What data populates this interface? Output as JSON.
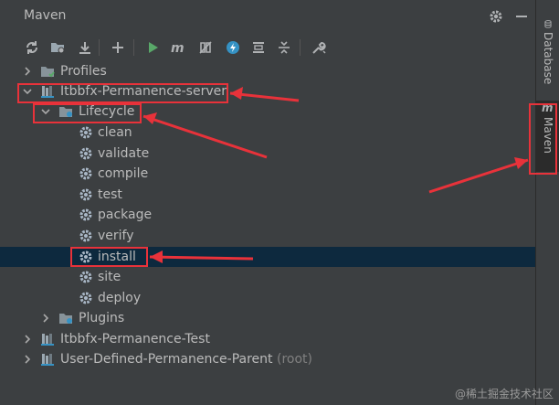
{
  "header": {
    "title": "Maven"
  },
  "tree": {
    "profiles": "Profiles",
    "project": "Itbbfx-Permanence-server",
    "lifecycle": "Lifecycle",
    "goals": [
      "clean",
      "validate",
      "compile",
      "test",
      "package",
      "verify",
      "install",
      "site",
      "deploy"
    ],
    "plugins": "Plugins",
    "test_project": "Itbbfx-Permanence-Test",
    "parent_project": "User-Defined-Permanence-Parent",
    "parent_suffix": "(root)"
  },
  "sidebar": {
    "database": "Database",
    "maven": "Maven"
  },
  "watermark": "@稀土掘金技术社区",
  "colors": {
    "background": "#3c3f41",
    "selection": "#0d293e",
    "annotation": "#e8323a",
    "run": "#59a869",
    "accent": "#3592c4"
  }
}
